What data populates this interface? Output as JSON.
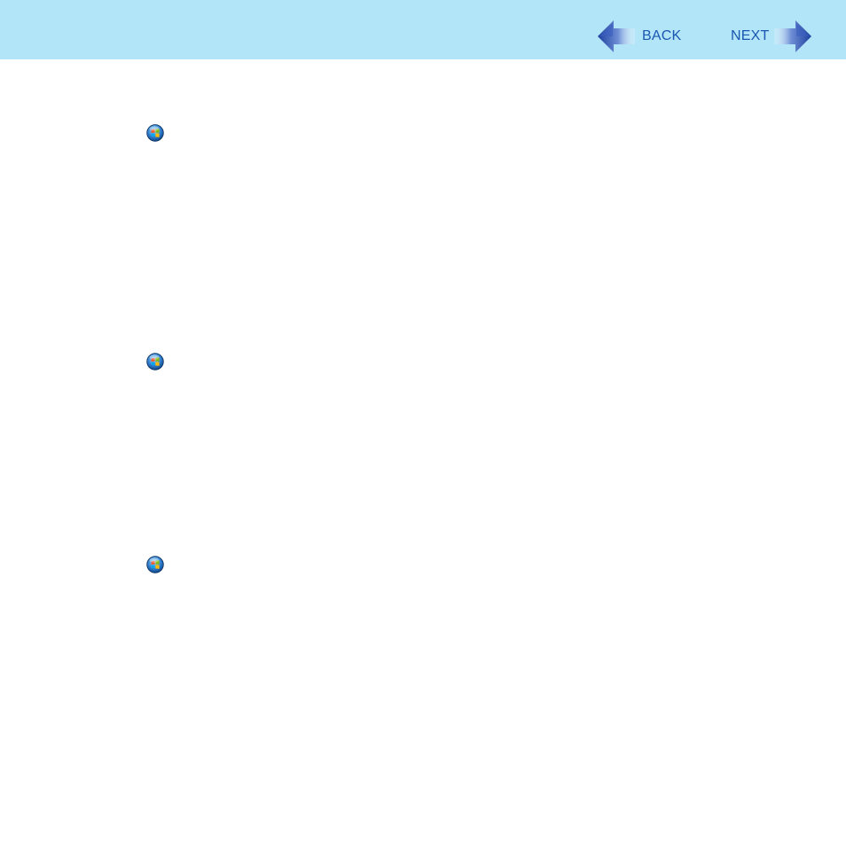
{
  "header": {
    "background_color": "#b3e5f9",
    "back_label": "BACK",
    "next_label": "NEXT",
    "label_color": "#1a57b0",
    "back_icon": "arrow-left-icon",
    "next_icon": "arrow-right-icon"
  },
  "content": {
    "icons": [
      {
        "name": "windows-start-icon"
      },
      {
        "name": "windows-start-icon"
      },
      {
        "name": "windows-start-icon"
      }
    ]
  }
}
